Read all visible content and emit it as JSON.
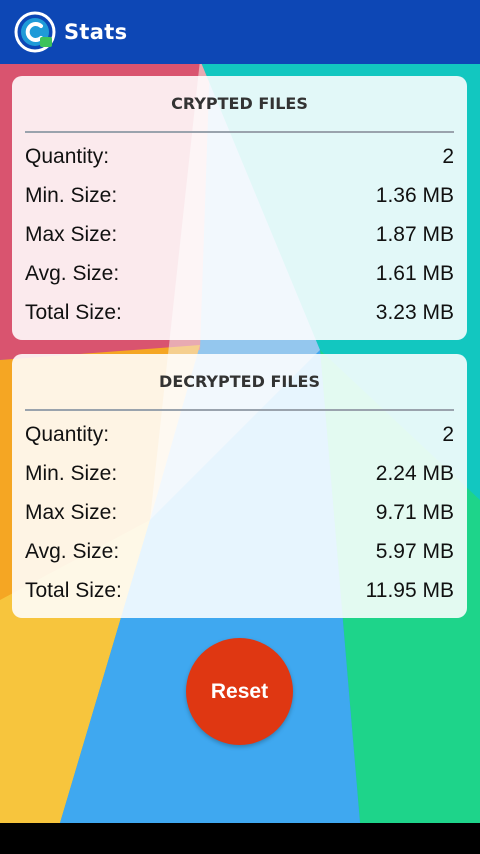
{
  "app": {
    "title": "Stats",
    "icon": "app-logo-icon"
  },
  "colors": {
    "appbar": "#0d47b5",
    "reset": "#df3712"
  },
  "crypted": {
    "title": "CRYPTED FILES",
    "rows": [
      {
        "label": "Quantity:",
        "value": "2"
      },
      {
        "label": "Min. Size:",
        "value": "1.36 MB"
      },
      {
        "label": "Max Size:",
        "value": "1.87 MB"
      },
      {
        "label": "Avg. Size:",
        "value": "1.61 MB"
      },
      {
        "label": "Total Size:",
        "value": "3.23 MB"
      }
    ]
  },
  "decrypted": {
    "title": "DECRYPTED FILES",
    "rows": [
      {
        "label": "Quantity:",
        "value": "2"
      },
      {
        "label": "Min. Size:",
        "value": "2.24 MB"
      },
      {
        "label": "Max Size:",
        "value": "9.71 MB"
      },
      {
        "label": "Avg. Size:",
        "value": "5.97 MB"
      },
      {
        "label": "Total Size:",
        "value": "11.95 MB"
      }
    ]
  },
  "reset": {
    "label": "Reset"
  }
}
